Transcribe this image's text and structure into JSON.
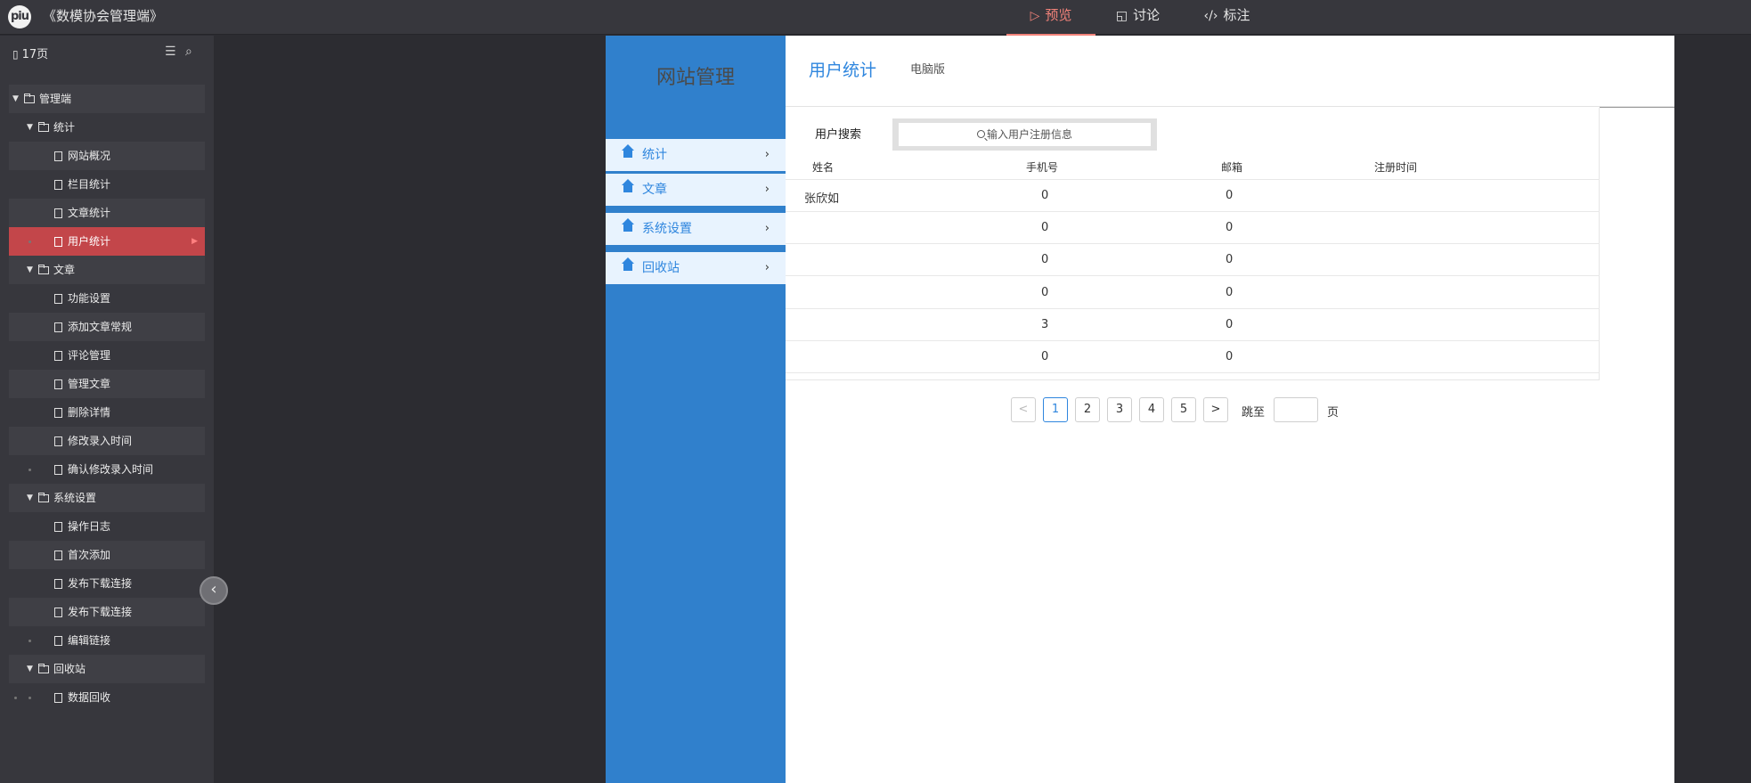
{
  "app": {
    "logo": "piu",
    "title": "《数模协会管理端》"
  },
  "top_tabs": [
    {
      "icon": "play-icon",
      "label": "预览",
      "active": true
    },
    {
      "icon": "discuss-icon",
      "label": "讨论",
      "active": false
    },
    {
      "icon": "code-icon",
      "label": "标注",
      "active": false
    }
  ],
  "left_panel": {
    "page_count": "17页",
    "tree": [
      {
        "label": "管理端",
        "type": "folder",
        "level": 0
      },
      {
        "label": "统计",
        "type": "folder",
        "level": 1
      },
      {
        "label": "网站概况",
        "type": "page",
        "level": 2
      },
      {
        "label": "栏目统计",
        "type": "page",
        "level": 2
      },
      {
        "label": "文章统计",
        "type": "page",
        "level": 2
      },
      {
        "label": "用户统计",
        "type": "page",
        "level": 2,
        "selected": true
      },
      {
        "label": "文章",
        "type": "folder",
        "level": 1
      },
      {
        "label": "功能设置",
        "type": "page",
        "level": 2
      },
      {
        "label": "添加文章常规",
        "type": "page",
        "level": 2
      },
      {
        "label": "评论管理",
        "type": "page",
        "level": 2
      },
      {
        "label": "管理文章",
        "type": "page",
        "level": 2
      },
      {
        "label": "删除详情",
        "type": "page",
        "level": 2
      },
      {
        "label": "修改录入时间",
        "type": "page",
        "level": 2
      },
      {
        "label": "确认修改录入时间",
        "type": "page",
        "level": 2
      },
      {
        "label": "系统设置",
        "type": "folder",
        "level": 1
      },
      {
        "label": "操作日志",
        "type": "page",
        "level": 2
      },
      {
        "label": "首次添加",
        "type": "page",
        "level": 2
      },
      {
        "label": "发布下载连接",
        "type": "page",
        "level": 2
      },
      {
        "label": "发布下载连接",
        "type": "page",
        "level": 2
      },
      {
        "label": "编辑链接",
        "type": "page",
        "level": 2
      },
      {
        "label": "回收站",
        "type": "folder",
        "level": 1
      },
      {
        "label": "数据回收",
        "type": "page",
        "level": 2
      }
    ]
  },
  "mock": {
    "site_title": "网站管理",
    "menu": [
      {
        "label": "统计"
      },
      {
        "label": "文章"
      },
      {
        "label": "系统设置"
      },
      {
        "label": "回收站"
      }
    ],
    "page_title": "用户统计",
    "page_subtitle": "电脑版",
    "search": {
      "label": "用户搜索",
      "placeholder": "输入用户注册信息"
    },
    "table": {
      "headers": [
        "姓名",
        "手机号",
        "邮箱",
        "注册时间"
      ],
      "rows": [
        [
          "张欣如",
          "0",
          "0",
          ""
        ],
        [
          "",
          "0",
          "0",
          ""
        ],
        [
          "",
          "0",
          "0",
          ""
        ],
        [
          "",
          "0",
          "0",
          ""
        ],
        [
          "",
          "3",
          "0",
          ""
        ],
        [
          "",
          "0",
          "0",
          ""
        ]
      ]
    },
    "pager": {
      "prev": "<",
      "pages": [
        "1",
        "2",
        "3",
        "4",
        "5"
      ],
      "current": "1",
      "next": ">",
      "jump_label": "跳至",
      "page_unit": "页"
    }
  },
  "colors": {
    "accent_red": "#c3464a",
    "brand_blue": "#3080cc",
    "link_blue": "#2f86de"
  }
}
